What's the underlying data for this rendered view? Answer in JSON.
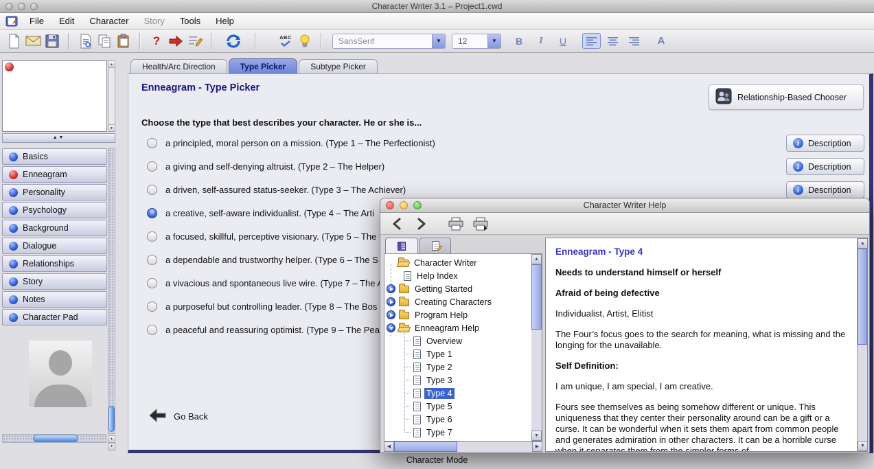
{
  "window": {
    "title": "Character Writer 3.1 – Project1.cwd",
    "status_label": "Character Mode"
  },
  "menu": {
    "items": [
      {
        "label": "File"
      },
      {
        "label": "Edit"
      },
      {
        "label": "Character"
      },
      {
        "label": "Story",
        "disabled": true
      },
      {
        "label": "Tools"
      },
      {
        "label": "Help"
      }
    ]
  },
  "toolbar": {
    "font_name": "SansSerif",
    "font_size": "12",
    "help_label": "?",
    "spell_label": "ABC",
    "bold_label": "B",
    "italic_label": "I",
    "underline_label": "U",
    "color_label": "A",
    "icons": [
      "new-document-icon",
      "mail-icon",
      "save-icon",
      "document-preview-icon",
      "copy-icon",
      "paste-icon",
      "help-icon",
      "red-arrow-icon",
      "edit-list-icon",
      "refresh-icon",
      "spell-check-icon",
      "idea-bulb-icon"
    ]
  },
  "sidebar": {
    "items": [
      {
        "label": "Basics",
        "orb": "blue"
      },
      {
        "label": "Enneagram",
        "orb": "red"
      },
      {
        "label": "Personality",
        "orb": "blue"
      },
      {
        "label": "Psychology",
        "orb": "blue"
      },
      {
        "label": "Background",
        "orb": "blue"
      },
      {
        "label": "Dialogue",
        "orb": "blue"
      },
      {
        "label": "Relationships",
        "orb": "blue"
      },
      {
        "label": "Story",
        "orb": "blue"
      },
      {
        "label": "Notes",
        "orb": "blue"
      },
      {
        "label": "Character Pad",
        "orb": "blue"
      }
    ]
  },
  "main": {
    "tabs": [
      {
        "label": "Health/Arc Direction",
        "selected": false
      },
      {
        "label": "Type Picker",
        "selected": true
      },
      {
        "label": "Subtype Picker",
        "selected": false
      }
    ],
    "heading": "Enneagram - Type Picker",
    "chooser_button_label": "Relationship-Based Chooser",
    "prompt": "Choose the type that best describes your character.  He or she is...",
    "options": [
      {
        "label": "a principled, moral person on a mission. (Type 1 – The Perfectionist)",
        "selected": false
      },
      {
        "label": "a giving and self-denying altruist. (Type 2 – The Helper)",
        "selected": false
      },
      {
        "label": "a driven, self-assured status-seeker. (Type 3 – The Achiever)",
        "selected": false
      },
      {
        "label": "a creative, self-aware individualist. (Type 4 – The Arti",
        "selected": true
      },
      {
        "label": "a focused, skillful, perceptive visionary. (Type 5 – The",
        "selected": false
      },
      {
        "label": "a dependable and trustworthy helper. (Type 6 – The S",
        "selected": false
      },
      {
        "label": "a vivacious and spontaneous live wire. (Type 7 – The A",
        "selected": false
      },
      {
        "label": "a purposeful but controlling leader. (Type 8 – The Bos",
        "selected": false
      },
      {
        "label": "a peaceful and reassuring optimist. (Type 9 – The Pea",
        "selected": false
      }
    ],
    "description_label": "Description",
    "go_back_label": "Go Back"
  },
  "help": {
    "title": "Character Writer Help",
    "tree": [
      {
        "label": "Character Writer",
        "icon": "open-folder"
      },
      {
        "label": "Help Index",
        "icon": "page"
      },
      {
        "label": "Getting Started",
        "icon": "folder",
        "expander": true
      },
      {
        "label": "Creating Characters",
        "icon": "folder",
        "expander": true
      },
      {
        "label": "Program Help",
        "icon": "folder",
        "expander": true
      },
      {
        "label": "Enneagram Help",
        "icon": "open-folder",
        "expander": true,
        "expanded": true
      },
      {
        "label": "Overview",
        "icon": "page",
        "child": true
      },
      {
        "label": "Type 1",
        "icon": "page",
        "child": true
      },
      {
        "label": "Type 2",
        "icon": "page",
        "child": true
      },
      {
        "label": "Type 3",
        "icon": "page",
        "child": true
      },
      {
        "label": "Type 4",
        "icon": "page",
        "child": true,
        "selected": true
      },
      {
        "label": "Type 5",
        "icon": "page",
        "child": true
      },
      {
        "label": "Type 6",
        "icon": "page",
        "child": true
      },
      {
        "label": "Type 7",
        "icon": "page",
        "child": true
      }
    ],
    "content": {
      "heading": "Enneagram - Type 4",
      "need": "Needs to understand himself or herself",
      "fear": "Afraid of being defective",
      "aliases": "Individualist, Artist, Elitist",
      "focus": "The Four’s focus goes to the search for meaning, what is missing and the longing for the unavailable.",
      "self_definition_label": "Self Definition:",
      "self_definition": "I am unique, I am special, I am creative.",
      "description": "Fours see themselves as being somehow different or unique. This uniqueness that they center their personality around can be a gift or a curse. It can be wonderful when it sets them apart from common people and generates admiration in other characters. It can be a horrible curse when it separates them from the simpler forms of"
    }
  },
  "colors": {
    "selected_tab": "#7589d9",
    "heading_navy": "#15157e",
    "help_heading_blue": "#3434c4",
    "selection_blue": "#3b63cf",
    "enneagram_red": "#cc2222",
    "nav_orb_blue": "#2a50c8"
  }
}
